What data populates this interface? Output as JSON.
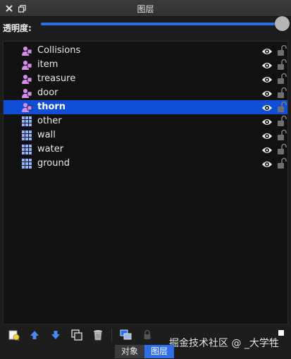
{
  "window": {
    "title": "图层"
  },
  "opacity": {
    "label": "透明度:",
    "value_fraction": 1.0
  },
  "layers": [
    {
      "name": "Collisions",
      "type": "object",
      "visible": true,
      "locked": false,
      "selected": false
    },
    {
      "name": "item",
      "type": "object",
      "visible": true,
      "locked": false,
      "selected": false
    },
    {
      "name": "treasure",
      "type": "object",
      "visible": true,
      "locked": false,
      "selected": false
    },
    {
      "name": "door",
      "type": "object",
      "visible": true,
      "locked": false,
      "selected": false
    },
    {
      "name": "thorn",
      "type": "object",
      "visible": true,
      "locked": false,
      "selected": true
    },
    {
      "name": "other",
      "type": "tile",
      "visible": true,
      "locked": false,
      "selected": false
    },
    {
      "name": "wall",
      "type": "tile",
      "visible": true,
      "locked": false,
      "selected": false
    },
    {
      "name": "water",
      "type": "tile",
      "visible": true,
      "locked": false,
      "selected": false
    },
    {
      "name": "ground",
      "type": "tile",
      "visible": true,
      "locked": false,
      "selected": false
    }
  ],
  "toolbar": {
    "icons": [
      "new-layer-icon",
      "raise-layer-icon",
      "lower-layer-icon",
      "duplicate-layer-icon",
      "delete-layer-icon",
      "show-hide-others-icon",
      "lock-icon"
    ]
  },
  "tabs": [
    {
      "label": "对象",
      "active": false
    },
    {
      "label": "图层",
      "active": true
    }
  ],
  "watermark": "掘金技术社区 @ _大学牲",
  "colors": {
    "accent": "#2f6fe6",
    "selection": "#0f4fd6",
    "object_layer_icon": "#d98cf0",
    "tile_layer_icon": "#8fb4ff"
  }
}
